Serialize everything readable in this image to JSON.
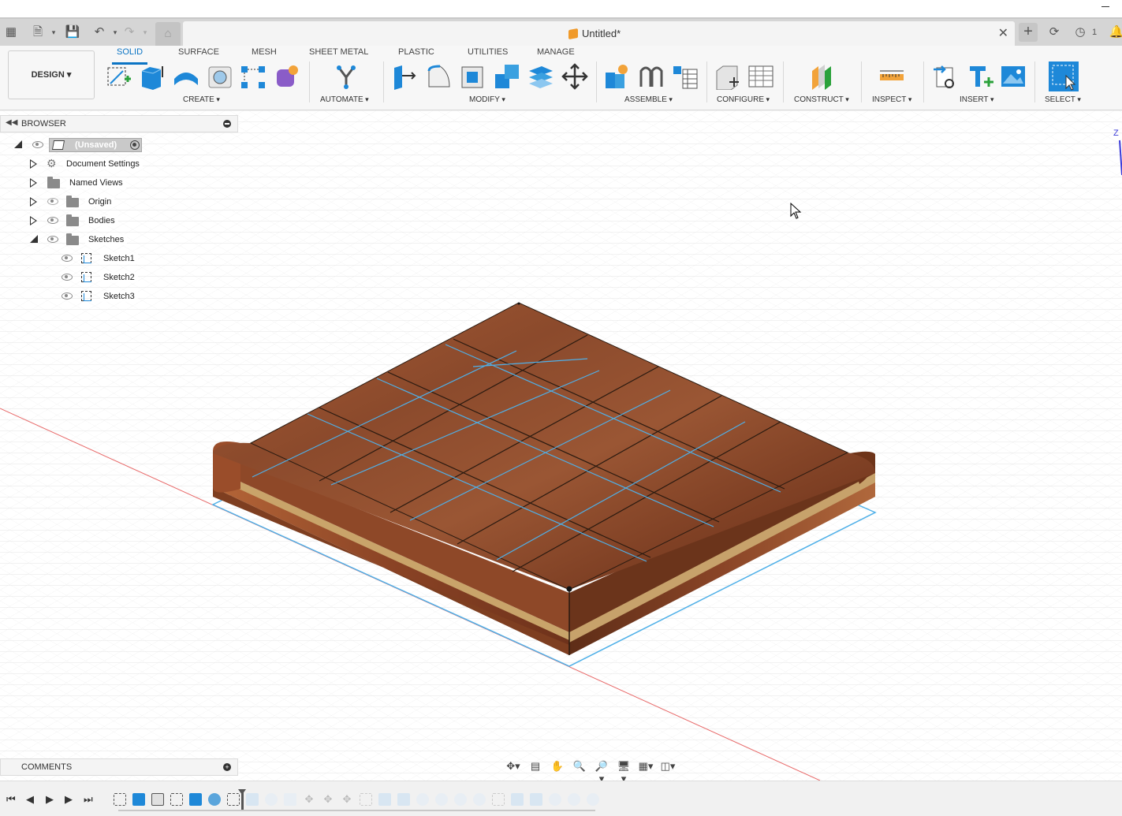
{
  "window": {
    "title": "Untitled*"
  },
  "toolbar": {
    "workspace": "DESIGN ▾",
    "tabs": [
      "SOLID",
      "SURFACE",
      "MESH",
      "SHEET METAL",
      "PLASTIC",
      "UTILITIES",
      "MANAGE"
    ],
    "active_tab": "SOLID",
    "groups": [
      "CREATE",
      "AUTOMATE",
      "MODIFY",
      "ASSEMBLE",
      "CONFIGURE",
      "CONSTRUCT",
      "INSPECT",
      "INSERT",
      "SELECT"
    ]
  },
  "browser": {
    "title": "BROWSER",
    "root": "(Unsaved)",
    "items": [
      {
        "label": "Document Settings",
        "icon": "gear-icon"
      },
      {
        "label": "Named Views",
        "icon": "folder-icon"
      },
      {
        "label": "Origin",
        "icon": "folder-icon",
        "hidden": true
      },
      {
        "label": "Bodies",
        "icon": "folder-icon"
      },
      {
        "label": "Sketches",
        "icon": "folder-icon",
        "expanded": true
      }
    ],
    "sketches": [
      "Sketch1",
      "Sketch2",
      "Sketch3"
    ]
  },
  "comments": {
    "title": "COMMENTS"
  },
  "header_right": {
    "notification_count": "1"
  },
  "colors": {
    "accent": "#0b74c4",
    "sketch_line": "#3aa0e0",
    "wood": "#8a4a2a",
    "wood_core": "#c9a46a"
  }
}
